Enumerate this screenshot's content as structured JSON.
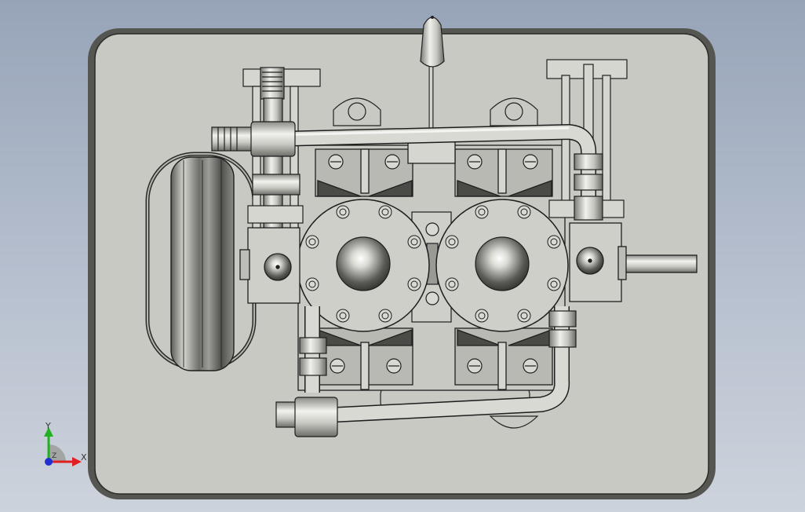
{
  "viewport": {
    "background_top": "#97a4b8",
    "background_bottom": "#cdd3dc",
    "part_color": "#c8c8c2",
    "edge_color": "#1e1e1e"
  },
  "triad": {
    "x_label": "X",
    "y_label": "Y",
    "z_label": "Z",
    "x_color": "#e02020",
    "y_color": "#20b020",
    "z_color": "#2030d0"
  }
}
